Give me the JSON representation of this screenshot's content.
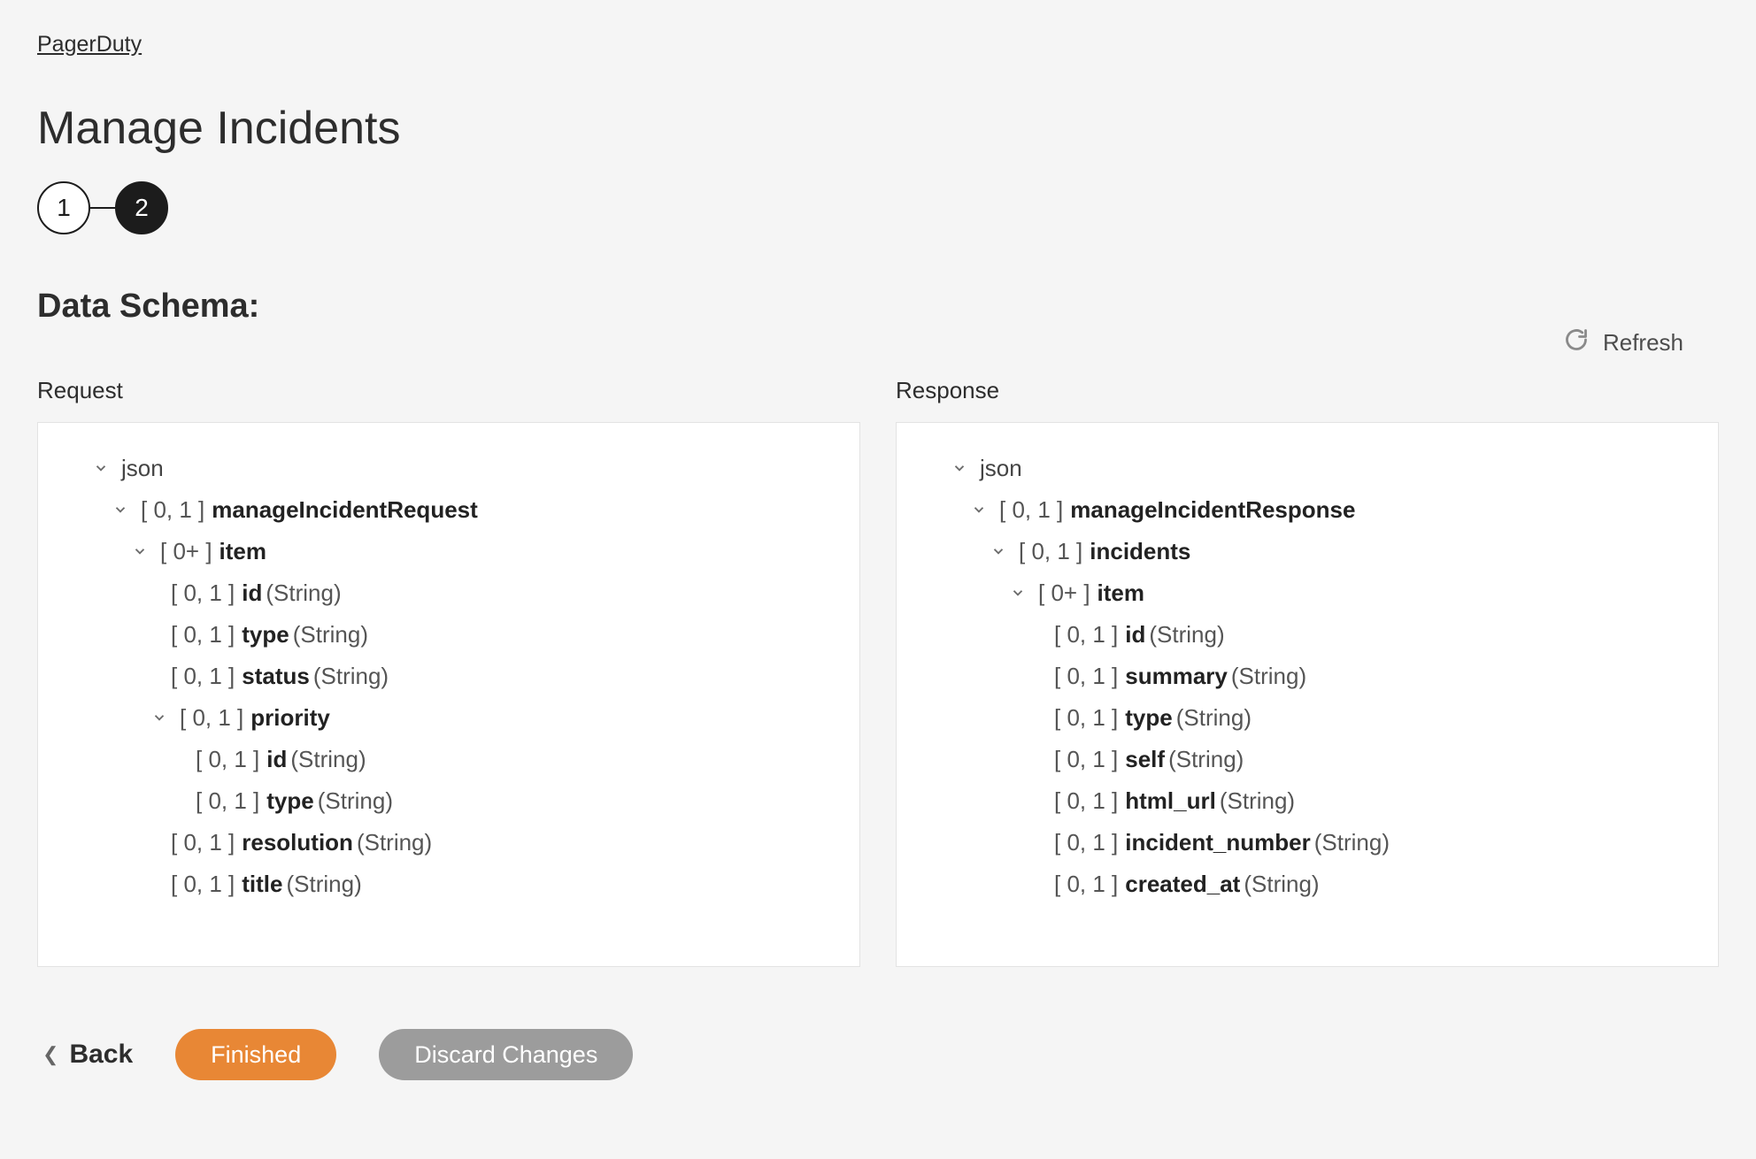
{
  "breadcrumb": "PagerDuty",
  "page_title": "Manage Incidents",
  "stepper": {
    "step1": "1",
    "step2": "2",
    "active_index": 1
  },
  "section_title": "Data Schema:",
  "refresh_label": "Refresh",
  "request_label": "Request",
  "response_label": "Response",
  "cards": {
    "c01": "[ 0, 1 ]",
    "c0p": "[ 0+ ]"
  },
  "dtype_string": "(String)",
  "request_tree": {
    "root": "json",
    "l1_name": "manageIncidentRequest",
    "item": "item",
    "id": "id",
    "type": "type",
    "status": "status",
    "priority": "priority",
    "priority_id": "id",
    "priority_type": "type",
    "resolution": "resolution",
    "title": "title"
  },
  "response_tree": {
    "root": "json",
    "l1_name": "manageIncidentResponse",
    "incidents": "incidents",
    "item": "item",
    "id": "id",
    "summary": "summary",
    "type": "type",
    "self": "self",
    "html_url": "html_url",
    "incident_number": "incident_number",
    "created_at": "created_at"
  },
  "footer": {
    "back": "Back",
    "finished": "Finished",
    "discard": "Discard Changes"
  }
}
